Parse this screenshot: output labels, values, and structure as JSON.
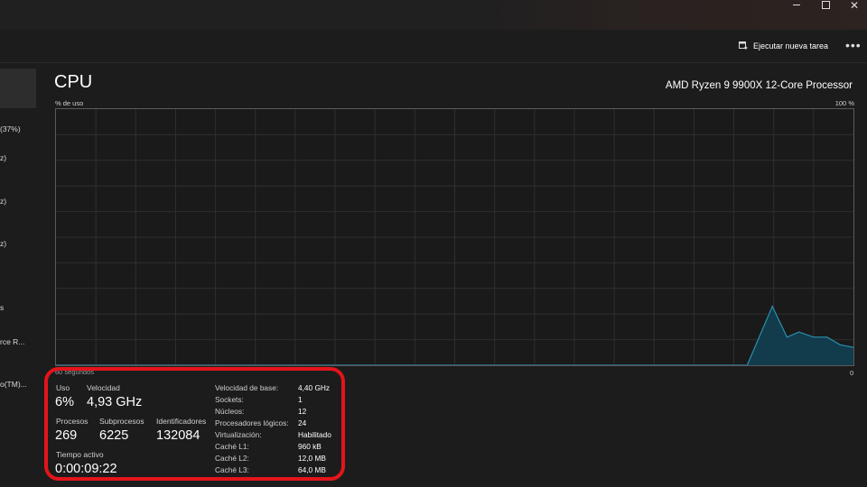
{
  "window": {
    "minimize_icon": "minimize-icon",
    "maximize_icon": "maximize-icon",
    "close_icon": "close-icon"
  },
  "toolbar": {
    "new_task_label": "Ejecutar nueva tarea",
    "new_task_icon": "run-task-icon",
    "more_label": "•••"
  },
  "sidebar": {
    "items": [
      {
        "label": "(37%)"
      },
      {
        "label": "z)"
      },
      {
        "label": "z)"
      },
      {
        "label": "z)"
      },
      {
        "label": "s"
      },
      {
        "label": "rce R..."
      },
      {
        "label": "o(TM)..."
      }
    ]
  },
  "header": {
    "title": "CPU",
    "processor": "AMD Ryzen 9 9900X 12-Core Processor"
  },
  "graph": {
    "y_label": "% de uso",
    "y_max_label": "100 %",
    "x_label": "60 segundos",
    "x_min_label": "0",
    "line_color": "#2a8fb0",
    "fill_color": "#123b4b",
    "grid_color": "#2f2f2f"
  },
  "chart_data": {
    "type": "area",
    "x": [
      60,
      8.0,
      6.1,
      5.0,
      4.1,
      3.0,
      2.0,
      1.0,
      0
    ],
    "values": [
      0,
      0,
      23,
      11,
      13,
      11,
      11,
      8,
      7
    ],
    "xlabel": "60 segundos",
    "ylabel": "% de uso",
    "ylim": [
      0,
      100
    ],
    "xlim": [
      60,
      0
    ],
    "grid": true
  },
  "stats": {
    "uso_label": "Uso",
    "uso_value": "6%",
    "velocidad_label": "Velocidad",
    "velocidad_value": "4,93 GHz",
    "procesos_label": "Procesos",
    "procesos_value": "269",
    "subprocesos_label": "Subprocesos",
    "subprocesos_value": "6225",
    "identificadores_label": "Identificadores",
    "identificadores_value": "132084",
    "tiempo_label": "Tiempo activo",
    "tiempo_value": "0:00:09:22"
  },
  "specs": [
    {
      "label": "Velocidad de base:",
      "value": "4,40 GHz"
    },
    {
      "label": "Sockets:",
      "value": "1"
    },
    {
      "label": "Núcleos:",
      "value": "12"
    },
    {
      "label": "Procesadores lógicos:",
      "value": "24"
    },
    {
      "label": "Virtualización:",
      "value": "Habilitado"
    },
    {
      "label": "Caché L1:",
      "value": "960 kB"
    },
    {
      "label": "Caché L2:",
      "value": "12,0 MB"
    },
    {
      "label": "Caché L3:",
      "value": "64,0 MB"
    }
  ],
  "highlight_color": "#e3141b"
}
